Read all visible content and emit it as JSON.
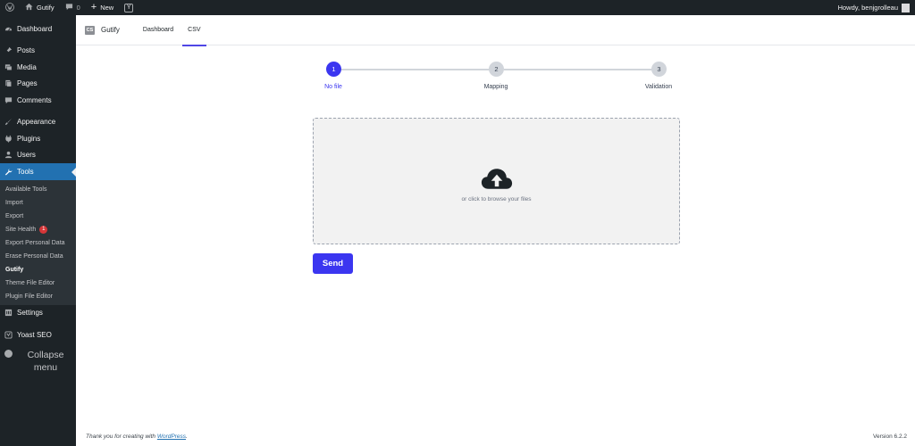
{
  "adminbar": {
    "site_name": "Gutify",
    "comments_count": "0",
    "new_label": "New",
    "yoast_label": "Y",
    "greeting": "Howdy, benjgrolleau"
  },
  "sidebar": {
    "items": [
      {
        "label": "Dashboard",
        "icon": "dashboard-icon"
      },
      {
        "label": "Posts",
        "icon": "pin-icon"
      },
      {
        "label": "Media",
        "icon": "media-icon"
      },
      {
        "label": "Pages",
        "icon": "pages-icon"
      },
      {
        "label": "Comments",
        "icon": "comment-icon"
      },
      {
        "label": "Appearance",
        "icon": "brush-icon"
      },
      {
        "label": "Plugins",
        "icon": "plug-icon"
      },
      {
        "label": "Users",
        "icon": "user-icon"
      },
      {
        "label": "Tools",
        "icon": "wrench-icon"
      },
      {
        "label": "Settings",
        "icon": "settings-icon"
      },
      {
        "label": "Yoast SEO",
        "icon": "yoast-icon"
      }
    ],
    "submenu": [
      {
        "label": "Available Tools"
      },
      {
        "label": "Import"
      },
      {
        "label": "Export"
      },
      {
        "label": "Site Health",
        "badge": "1"
      },
      {
        "label": "Export Personal Data"
      },
      {
        "label": "Erase Personal Data"
      },
      {
        "label": "Gutify"
      },
      {
        "label": "Theme File Editor"
      },
      {
        "label": "Plugin File Editor"
      }
    ],
    "collapse_label": "Collapse menu"
  },
  "topnav": {
    "logo_text": "CS",
    "brand": "Gutify",
    "tabs": [
      {
        "label": "Dashboard"
      },
      {
        "label": "CSV"
      }
    ]
  },
  "stepper": {
    "steps": [
      {
        "number": "1",
        "label": "No file"
      },
      {
        "number": "2",
        "label": "Mapping"
      },
      {
        "number": "3",
        "label": "Validation"
      }
    ]
  },
  "dropzone": {
    "icon": "cloud-upload-icon",
    "text": "or click to browse your files"
  },
  "actions": {
    "send_label": "Send"
  },
  "footer": {
    "thanks_prefix": "Thank you for creating with",
    "wordpress_link": "WordPress",
    "thanks_suffix": ".",
    "version": "Version 6.2.2"
  },
  "colors": {
    "accent": "#3b36f0",
    "admin_dark": "#1d2327",
    "wp_blue": "#2271b1"
  }
}
